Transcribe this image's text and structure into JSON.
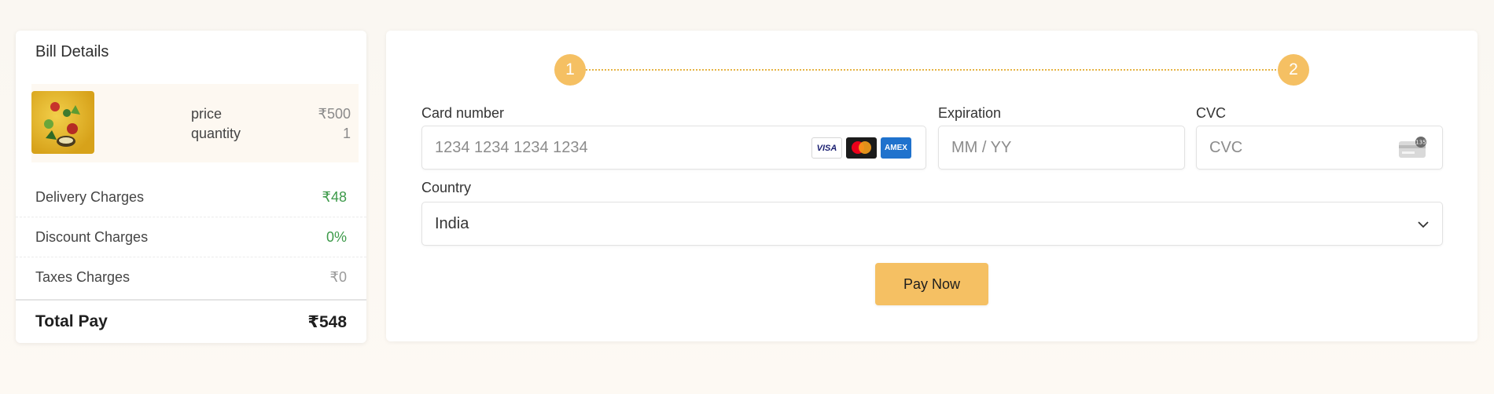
{
  "bill": {
    "title": "Bill Details",
    "item": {
      "price_label": "price",
      "price_value": "₹500",
      "quantity_label": "quantity",
      "quantity_value": "1"
    },
    "charges": [
      {
        "label": "Delivery Charges",
        "value": "₹48"
      },
      {
        "label": "Discount Charges",
        "value": "0%"
      },
      {
        "label": "Taxes Charges",
        "value": "₹0"
      }
    ],
    "total": {
      "label": "Total Pay",
      "value": "₹548"
    }
  },
  "payment": {
    "steps": [
      "1",
      "2"
    ],
    "card_number": {
      "label": "Card number",
      "placeholder": "1234 1234 1234 1234"
    },
    "card_brands": [
      "VISA",
      "mastercard",
      "AMEX"
    ],
    "expiration": {
      "label": "Expiration",
      "placeholder": "MM / YY"
    },
    "cvc": {
      "label": "CVC",
      "placeholder": "CVC",
      "icon_text": "135"
    },
    "country": {
      "label": "Country",
      "value": "India"
    },
    "pay_button": "Pay Now"
  },
  "colors": {
    "accent": "#f5c063",
    "green": "#3d9a4a"
  }
}
